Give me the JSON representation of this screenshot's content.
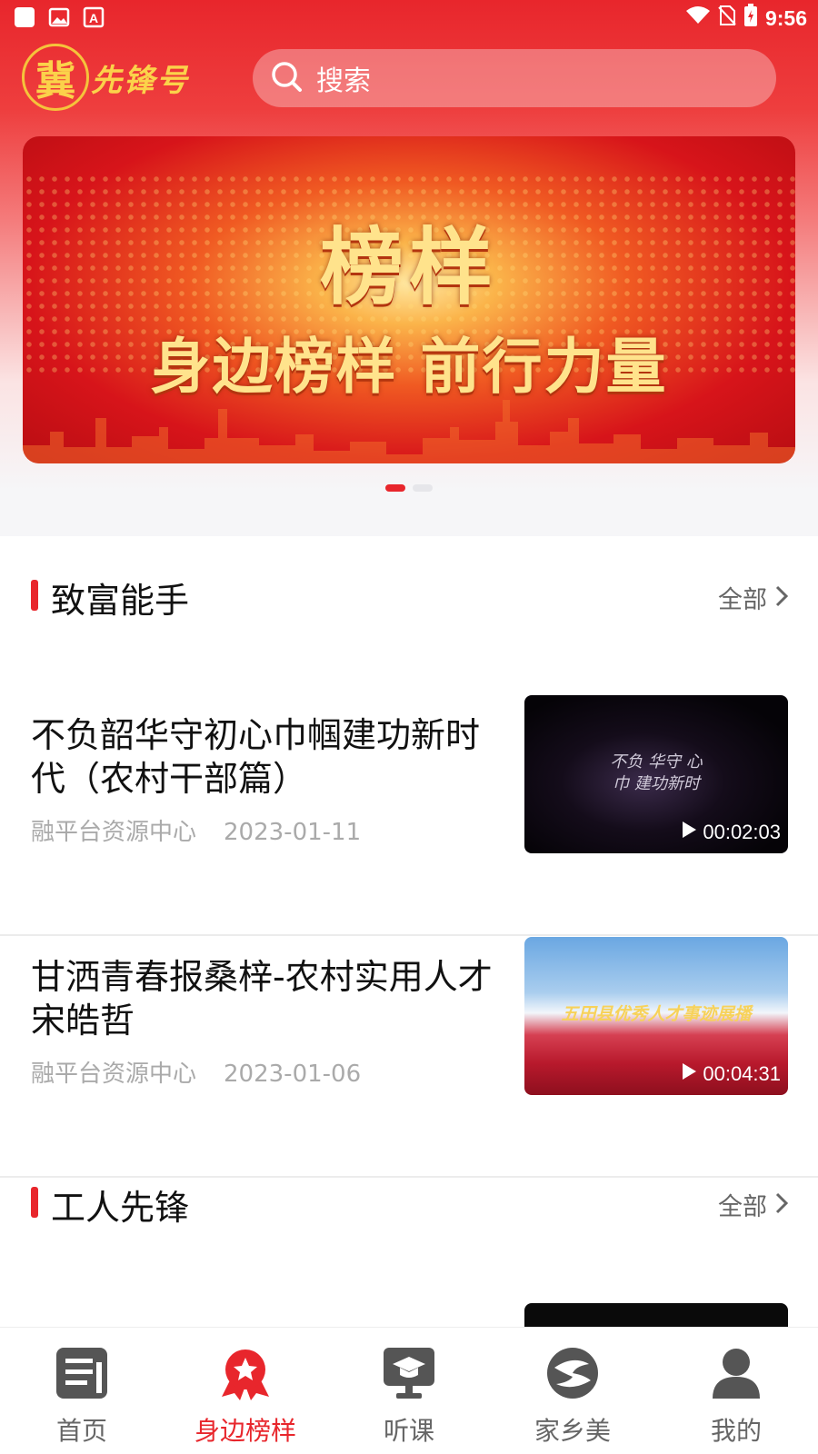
{
  "status_bar": {
    "time": "9:56"
  },
  "header": {
    "logo_seal": "冀",
    "logo_text": "先锋号",
    "search_placeholder": "搜索"
  },
  "banner": {
    "title": "榜样",
    "subtitle": "身边榜样 前行力量",
    "pages": 2,
    "active_page": 1
  },
  "sections": [
    {
      "title": "致富能手",
      "more": "全部",
      "articles": [
        {
          "title": "不负韶华守初心巾帼建功新时代（农村干部篇）",
          "source": "融平台资源中心",
          "date": "2023-01-11",
          "duration": "00:02:03",
          "thumb_caption": "不负 华守 心\n巾 建功新时"
        },
        {
          "title": "甘洒青春报桑梓-农村实用人才宋皓哲",
          "source": "融平台资源中心",
          "date": "2023-01-06",
          "duration": "00:04:31",
          "thumb_caption": "五田县优秀人才事迹展播"
        }
      ]
    },
    {
      "title": "工人先锋",
      "more": "全部"
    }
  ],
  "tabbar": {
    "items": [
      {
        "label": "首页",
        "icon": "news-icon",
        "active": false
      },
      {
        "label": "身边榜样",
        "icon": "medal-icon",
        "active": true
      },
      {
        "label": "听课",
        "icon": "lecture-icon",
        "active": false
      },
      {
        "label": "家乡美",
        "icon": "hometown-icon",
        "active": false
      },
      {
        "label": "我的",
        "icon": "user-icon",
        "active": false
      }
    ]
  },
  "colors": {
    "brand_red": "#e8262c",
    "gold": "#fbd24a",
    "inactive_gray": "#666666"
  }
}
